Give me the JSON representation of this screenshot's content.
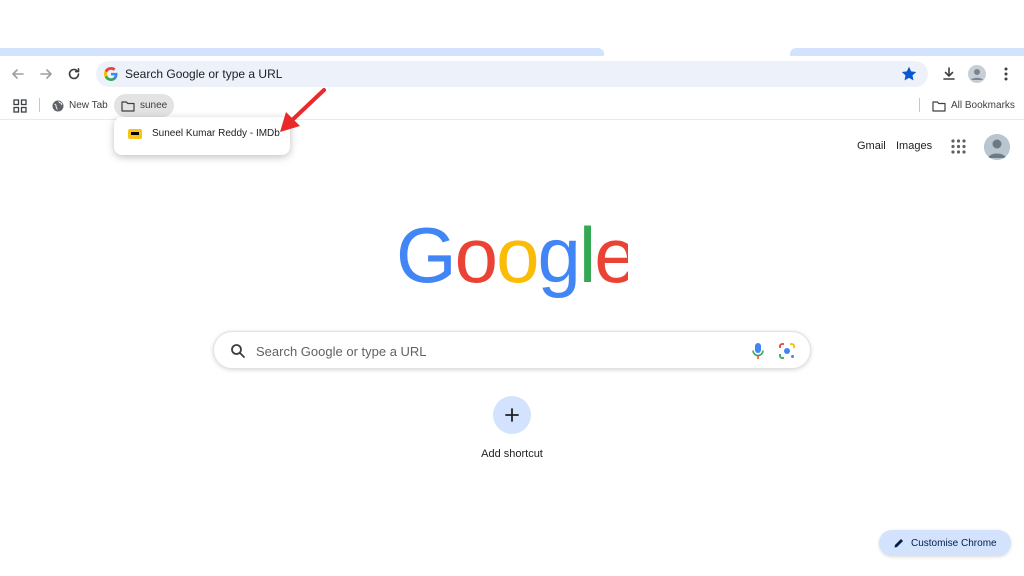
{
  "omnibox": {
    "text": "Search Google or type a URL"
  },
  "bookmarks_bar": {
    "items": [
      {
        "label": "New Tab",
        "icon": "globe-icon"
      },
      {
        "label": "sunee",
        "icon": "folder-icon"
      }
    ],
    "all_bookmarks_label": "All Bookmarks"
  },
  "dropdown": {
    "items": [
      {
        "label": "Suneel Kumar Reddy - IMDb",
        "icon": "imdb-icon"
      }
    ]
  },
  "header": {
    "gmail_label": "Gmail",
    "images_label": "Images"
  },
  "search": {
    "placeholder": "Search Google or type a URL"
  },
  "shortcut": {
    "label": "Add shortcut"
  },
  "customise": {
    "label": "Customise Chrome"
  },
  "colors": {
    "accent": "#d3e3fd",
    "bookmark_star": "#0b57d0",
    "arrow": "#ea2a2a",
    "google_blue": "#4285f4",
    "google_red": "#ea4335",
    "google_yellow": "#fbbc05",
    "google_green": "#34a853"
  }
}
